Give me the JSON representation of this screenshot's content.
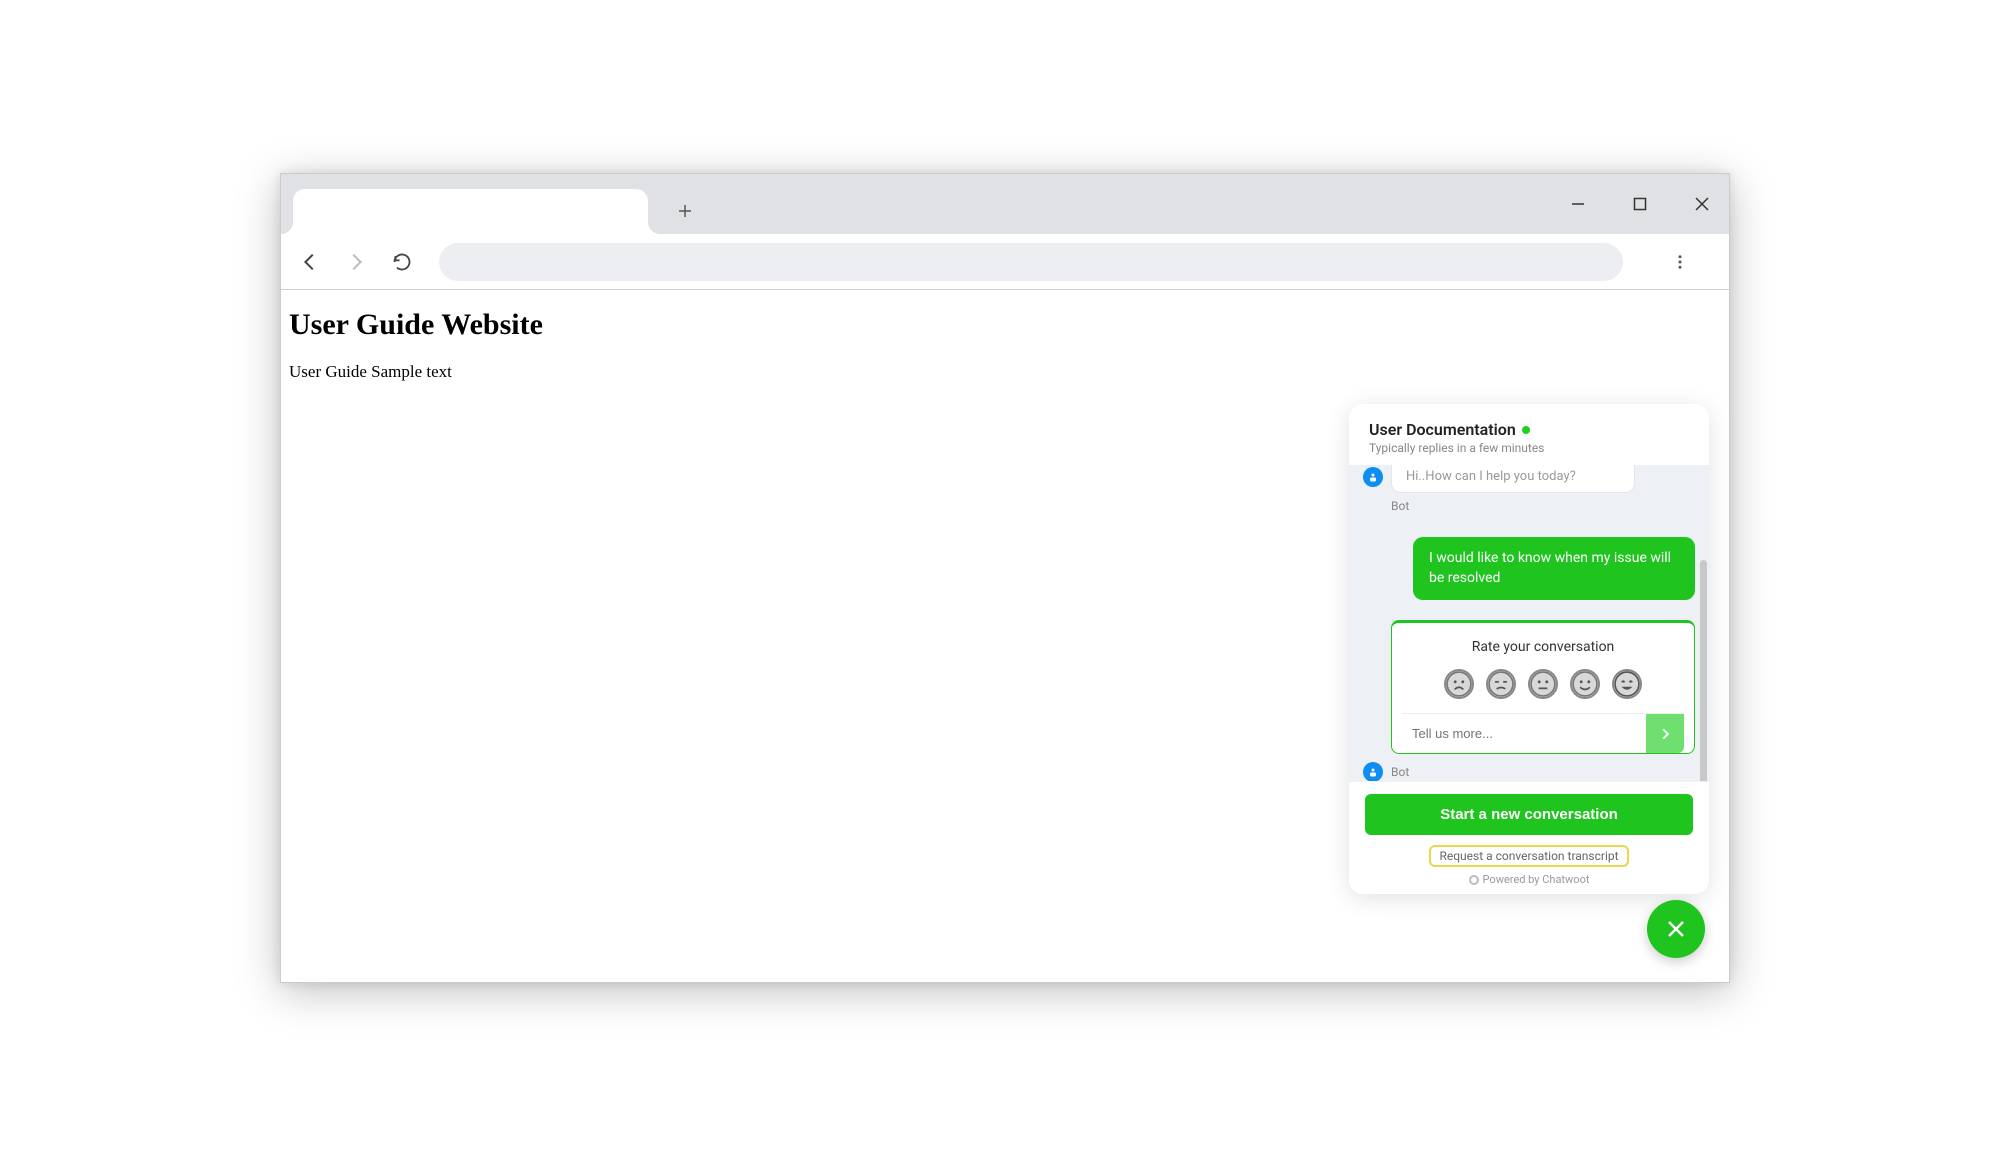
{
  "browser": {
    "new_tab_tooltip": "New tab"
  },
  "page": {
    "heading": "User Guide Website",
    "body_text": "User Guide Sample text"
  },
  "chat": {
    "title": "User Documentation",
    "subtitle": "Typically replies in a few minutes",
    "bot_partial_message": "Hi..How can I help you today?",
    "bot_label": "Bot",
    "user_message": "I would like to know when my issue will be resolved",
    "rating_title": "Rate your conversation",
    "feedback_placeholder": "Tell us more...",
    "bot_label2": "Bot",
    "new_conversation": "Start a new conversation",
    "transcript": "Request a conversation transcript",
    "powered": "Powered by Chatwoot"
  }
}
